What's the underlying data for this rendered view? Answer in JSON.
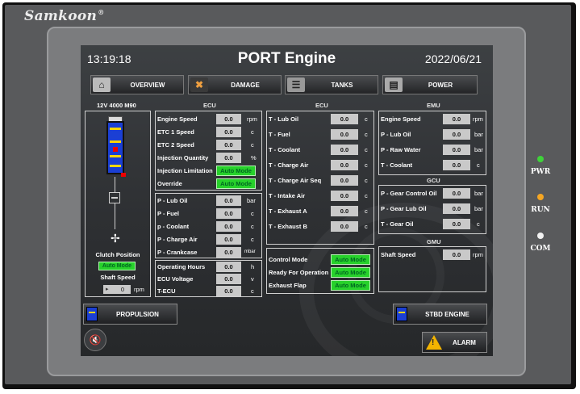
{
  "brand": {
    "name": "Samkoon",
    "mark": "®"
  },
  "header": {
    "time": "13:19:18",
    "title": "PORT Engine",
    "date": "2022/06/21"
  },
  "nav": [
    {
      "label": "OVERVIEW",
      "icon": "home-icon"
    },
    {
      "label": "DAMAGE",
      "icon": "tools-icon"
    },
    {
      "label": "TANKS",
      "icon": "tank-icon"
    },
    {
      "label": "POWER",
      "icon": "generator-icon"
    }
  ],
  "left": {
    "model": "12V 4000 M90",
    "clutch_label": "Clutch Position",
    "clutch_state": "Auto Mode",
    "shaft_label": "Shaft Speed",
    "shaft_value": "0",
    "shaft_unit": "rpm"
  },
  "ecu1": {
    "title": "ECU",
    "group1": [
      {
        "label": "Engine Speed",
        "value": "0.0",
        "unit": "rpm"
      },
      {
        "label": "ETC 1 Speed",
        "value": "0.0",
        "unit": "c"
      },
      {
        "label": "ETC 2 Speed",
        "value": "0.0",
        "unit": "c"
      },
      {
        "label": "Injection Quantity",
        "value": "0.0",
        "unit": "%"
      },
      {
        "label": "Injection Limitation",
        "state": "Auto Mode"
      },
      {
        "label": "Override",
        "state": "Auto Mode"
      }
    ],
    "group2": [
      {
        "label": "P - Lub Oil",
        "value": "0.0",
        "unit": "bar"
      },
      {
        "label": "P - Fuel",
        "value": "0.0",
        "unit": "c"
      },
      {
        "label": "p - Coolant",
        "value": "0.0",
        "unit": "c"
      },
      {
        "label": "P - Charge Air",
        "value": "0.0",
        "unit": "c"
      },
      {
        "label": "P - Crankcase",
        "value": "0.0",
        "unit": "mbar"
      }
    ],
    "group3": [
      {
        "label": "Operating Hours",
        "value": "0.0",
        "unit": "h"
      },
      {
        "label": "ECU Voltage",
        "value": "0.0",
        "unit": "v"
      },
      {
        "label": "T-ECU",
        "value": "0.0",
        "unit": "c"
      }
    ]
  },
  "ecu2": {
    "title": "ECU",
    "temps": [
      {
        "label": "T - Lub Oil",
        "value": "0.0",
        "unit": "c"
      },
      {
        "label": "T - Fuel",
        "value": "0.0",
        "unit": "c"
      },
      {
        "label": "T - Coolant",
        "value": "0.0",
        "unit": "c"
      },
      {
        "label": "T - Charge Air",
        "value": "0.0",
        "unit": "c"
      },
      {
        "label": "T - Charge Air Seq",
        "value": "0.0",
        "unit": "c"
      },
      {
        "label": "T - Intake Air",
        "value": "0.0",
        "unit": "c"
      },
      {
        "label": "T - Exhaust A",
        "value": "0.0",
        "unit": "c"
      },
      {
        "label": "T - Exhaust B",
        "value": "0.0",
        "unit": "c"
      }
    ],
    "modes": [
      {
        "label": "Control Mode",
        "state": "Auto Mode"
      },
      {
        "label": "Ready For Operation",
        "state": "Auto Mode"
      },
      {
        "label": "Exhaust Flap",
        "state": "Auto Mode"
      }
    ]
  },
  "emu": {
    "title": "EMU",
    "rows": [
      {
        "label": "Engine Speed",
        "value": "0.0",
        "unit": "rpm"
      },
      {
        "label": "P - Lub Oil",
        "value": "0.0",
        "unit": "bar"
      },
      {
        "label": "P - Raw Water",
        "value": "0.0",
        "unit": "bar"
      },
      {
        "label": "T - Coolant",
        "value": "0.0",
        "unit": "c"
      }
    ]
  },
  "gcu": {
    "title": "GCU",
    "rows": [
      {
        "label": "P - Gear Control Oil",
        "value": "0.0",
        "unit": "bar"
      },
      {
        "label": "P - Gear Lub Oil",
        "value": "0.0",
        "unit": "bar"
      },
      {
        "label": "T - Gear Oil",
        "value": "0.0",
        "unit": "c"
      }
    ]
  },
  "gmu": {
    "title": "GMU",
    "rows": [
      {
        "label": "Shaft Speed",
        "value": "0.0",
        "unit": "rpm"
      }
    ]
  },
  "bottom": {
    "propulsion": "PROPULSION",
    "stbd": "STBD ENGINE",
    "alarm": "ALARM"
  },
  "leds": [
    {
      "label": "PWR",
      "color": "#3fd23a"
    },
    {
      "label": "RUN",
      "color": "#f5a623"
    },
    {
      "label": "COM",
      "color": "#f2f2f2"
    }
  ]
}
